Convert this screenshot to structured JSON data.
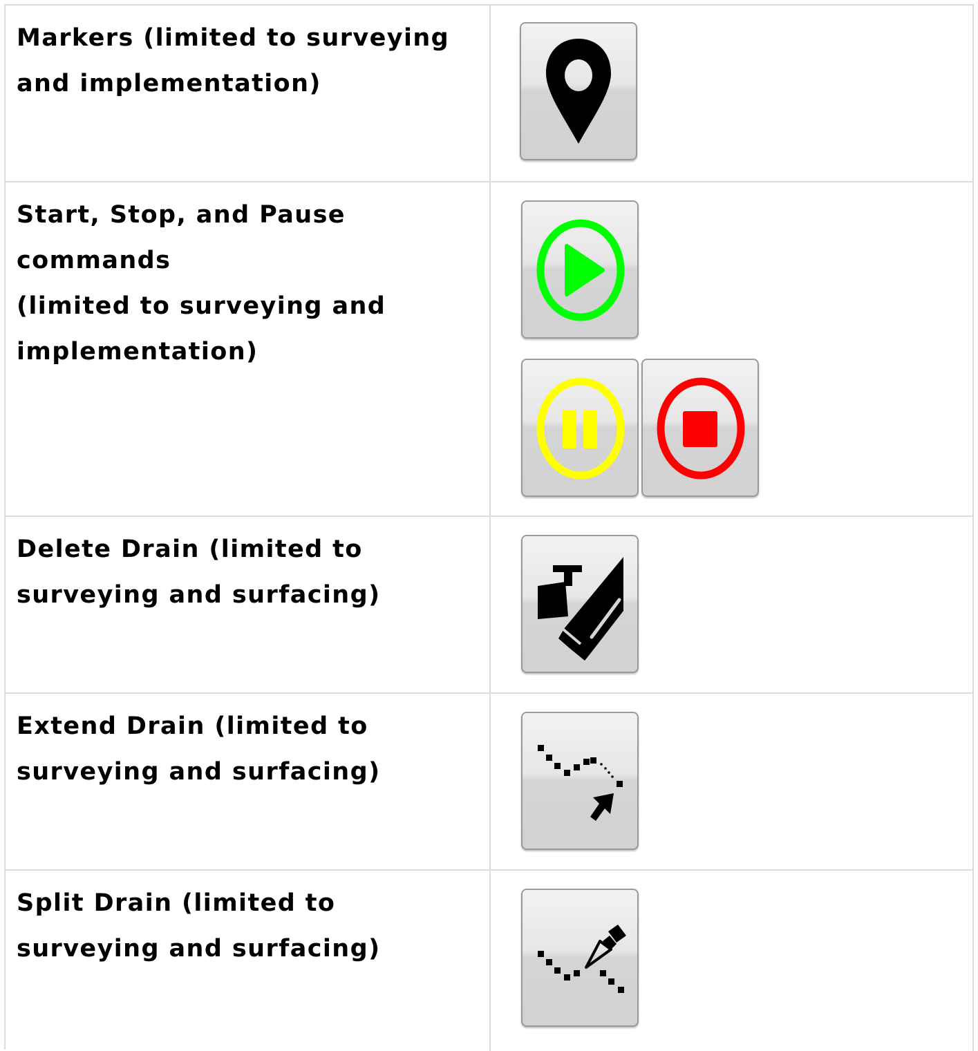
{
  "rows": [
    {
      "label_lines": [
        "Markers (limited to surveying",
        "and implementation)"
      ],
      "icons": [
        "map-marker-icon"
      ]
    },
    {
      "label_lines": [
        "Start, Stop, and Pause",
        "commands",
        "(limited to surveying and",
        "implementation)"
      ],
      "icons": [
        "play-icon",
        "pause-icon",
        "stop-icon"
      ]
    },
    {
      "label_lines": [
        "Delete Drain (limited to",
        "surveying and surfacing)"
      ],
      "icons": [
        "delete-drain-icon"
      ]
    },
    {
      "label_lines": [
        "Extend Drain (limited to",
        "surveying and surfacing)"
      ],
      "icons": [
        "extend-drain-icon"
      ]
    },
    {
      "label_lines": [
        "Split Drain (limited to",
        "surveying and surfacing)"
      ],
      "icons": [
        "split-drain-icon"
      ]
    }
  ],
  "colors": {
    "play": "#00ff00",
    "pause": "#ffff00",
    "stop": "#ff0000",
    "icon_dark": "#000000"
  }
}
